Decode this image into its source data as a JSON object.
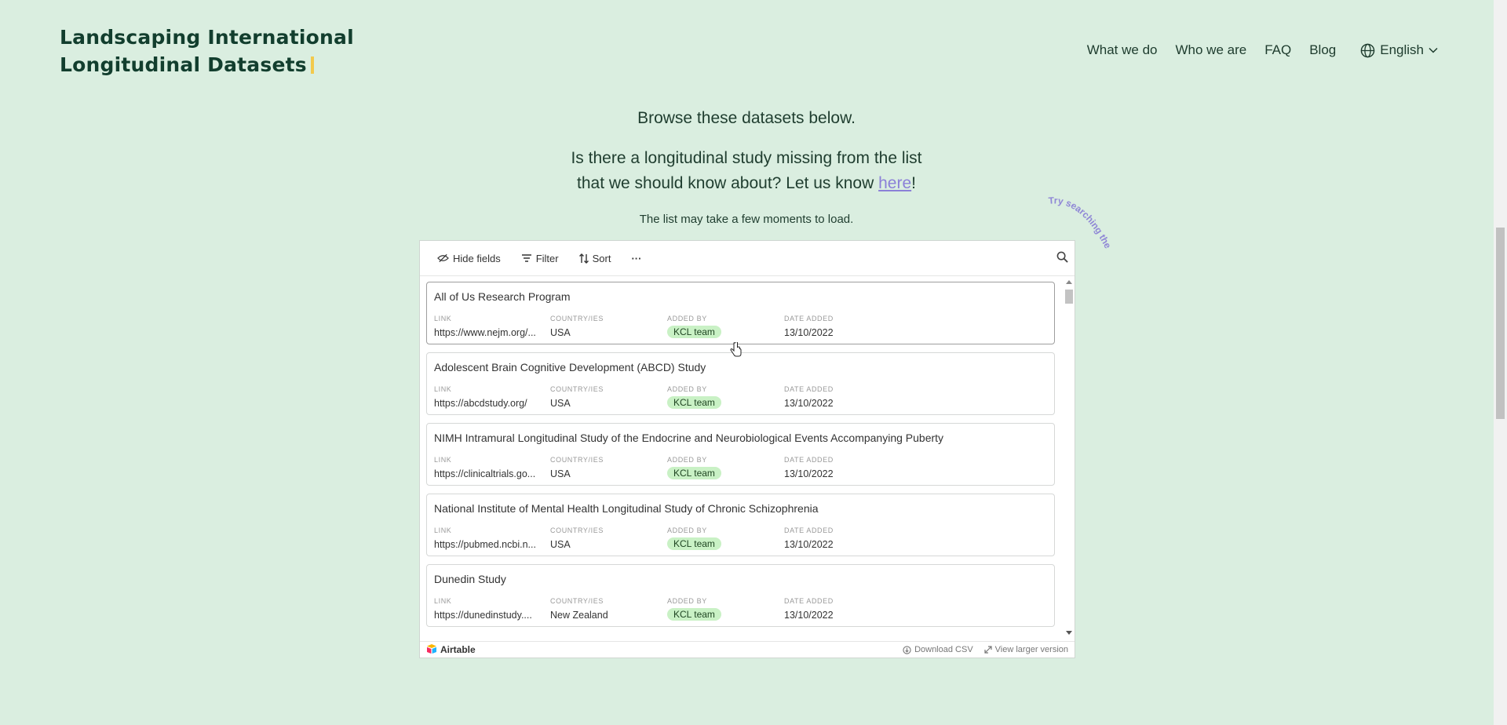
{
  "site": {
    "title_line1": "Landscaping International",
    "title_line2": "Longitudinal Datasets"
  },
  "nav": {
    "items": [
      "What we do",
      "Who we are",
      "FAQ",
      "Blog"
    ],
    "language": "English"
  },
  "intro": {
    "browse": "Browse these datasets below.",
    "question_line1": "Is there a longitudinal study missing from the list",
    "question_line2_prefix": "that we should know about? Let us know ",
    "question_link": "here",
    "question_suffix": "!",
    "load_note": "The list may take a few moments to load.",
    "hint": "Try searching the list!"
  },
  "toolbar": {
    "hide_fields": "Hide fields",
    "filter": "Filter",
    "sort": "Sort",
    "more": "···"
  },
  "columns": {
    "link": "LINK",
    "country": "COUNTRY/IES",
    "added_by": "ADDED BY",
    "date_added": "DATE ADDED"
  },
  "records": [
    {
      "title": "All of Us Research Program",
      "link": "https://www.nejm.org/...",
      "country": "USA",
      "added_by": "KCL team",
      "date": "13/10/2022"
    },
    {
      "title": "Adolescent Brain Cognitive Development (ABCD) Study",
      "link": "https://abcdstudy.org/",
      "country": "USA",
      "added_by": "KCL team",
      "date": "13/10/2022"
    },
    {
      "title": "NIMH Intramural Longitudinal Study of the Endocrine and Neurobiological Events Accompanying Puberty",
      "link": "https://clinicaltrials.go...",
      "country": "USA",
      "added_by": "KCL team",
      "date": "13/10/2022"
    },
    {
      "title": "National Institute of Mental Health Longitudinal Study of Chronic Schizophrenia",
      "link": "https://pubmed.ncbi.n...",
      "country": "USA",
      "added_by": "KCL team",
      "date": "13/10/2022"
    },
    {
      "title": "Dunedin Study",
      "link": "https://dunedinstudy....",
      "country": "New Zealand",
      "added_by": "KCL team",
      "date": "13/10/2022"
    }
  ],
  "footer": {
    "brand": "Airtable",
    "download": "Download CSV",
    "larger": "View larger version"
  }
}
